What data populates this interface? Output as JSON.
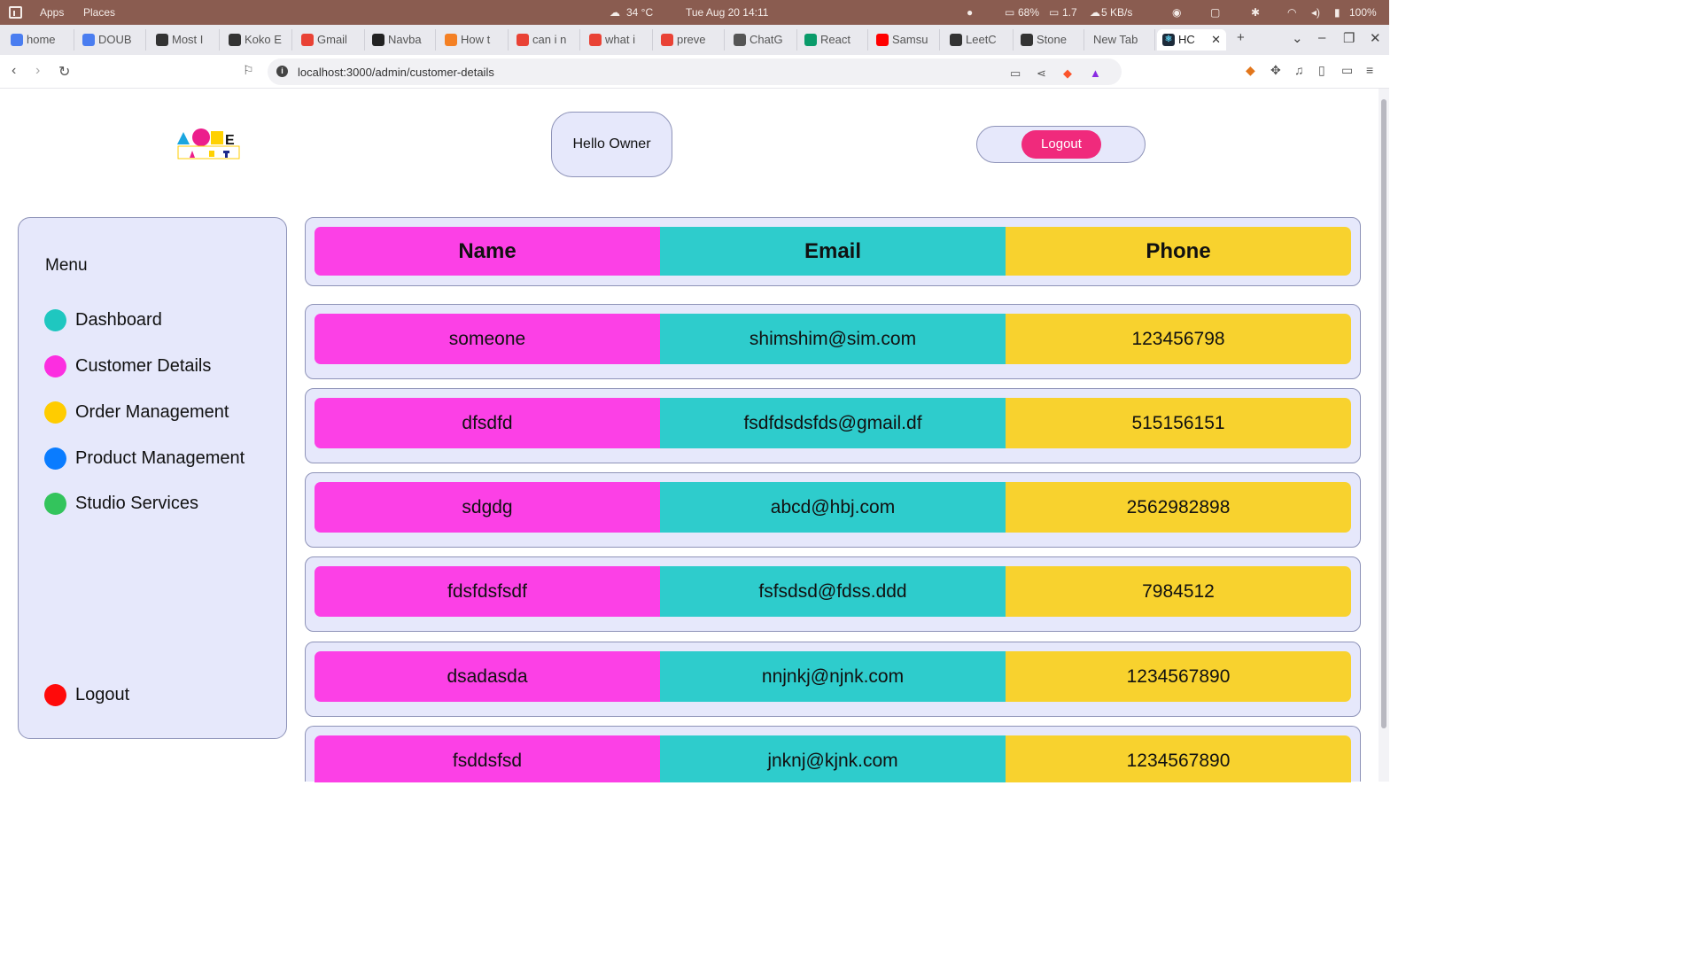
{
  "os_bar": {
    "apps": "Apps",
    "places": "Places",
    "weather": "34 °C",
    "datetime": "Tue Aug 20  14:11",
    "cpu": "68%",
    "load": "1.7",
    "net": "5 KB/s",
    "battery": "100%"
  },
  "tabs": [
    {
      "title": "home",
      "icon": "doc-icon",
      "color": "#4a7df0"
    },
    {
      "title": "DOUB",
      "icon": "doc-icon",
      "color": "#4a7df0"
    },
    {
      "title": "Most I",
      "icon": "leetcode-icon",
      "color": "#333333"
    },
    {
      "title": "Koko E",
      "icon": "leetcode-icon",
      "color": "#333333"
    },
    {
      "title": "Gmail",
      "icon": "google-icon",
      "color": "#e94235"
    },
    {
      "title": "Navba",
      "icon": "github-icon",
      "color": "#222222"
    },
    {
      "title": "How t",
      "icon": "stackoverflow-icon",
      "color": "#f48024"
    },
    {
      "title": "can i n",
      "icon": "google-icon",
      "color": "#e94235"
    },
    {
      "title": "what i",
      "icon": "google-icon",
      "color": "#e94235"
    },
    {
      "title": "preve",
      "icon": "google-icon",
      "color": "#e94235"
    },
    {
      "title": "ChatG",
      "icon": "chatgpt-icon",
      "color": "#555555"
    },
    {
      "title": "React",
      "icon": "w-icon",
      "color": "#0a9b6a"
    },
    {
      "title": "Samsu",
      "icon": "youtube-icon",
      "color": "#ff0000"
    },
    {
      "title": "LeetC",
      "icon": "leetcode-icon",
      "color": "#333333"
    },
    {
      "title": "Stone",
      "icon": "leetcode-icon",
      "color": "#333333"
    },
    {
      "title": "New Tab",
      "icon": "",
      "color": "#e9e9ee"
    }
  ],
  "active_tab": {
    "title": "HC",
    "icon": "react-icon"
  },
  "address_bar": {
    "url": "localhost:3000/admin/customer-details"
  },
  "header": {
    "greeting": "Hello Owner",
    "logout_label": "Logout"
  },
  "sidebar": {
    "title": "Menu",
    "items": [
      {
        "label": "Dashboard",
        "color": "#1fc7c0"
      },
      {
        "label": "Customer Details",
        "color": "#fc2ee0"
      },
      {
        "label": "Order Management",
        "color": "#ffcc00"
      },
      {
        "label": "Product Management",
        "color": "#0a7cff"
      },
      {
        "label": "Studio Services",
        "color": "#33c45c"
      }
    ],
    "logout": {
      "label": "Logout",
      "color": "#ff0a0a"
    }
  },
  "table": {
    "headers": [
      "Name",
      "Email",
      "Phone"
    ],
    "rows": [
      [
        "someone",
        "shimshim@sim.com",
        "123456798"
      ],
      [
        "dfsdfd",
        "fsdfdsdsfds@gmail.df",
        "515156151"
      ],
      [
        "sdgdg",
        "abcd@hbj.com",
        "2562982898"
      ],
      [
        "fdsfdsfsdf",
        "fsfsdsd@fdss.ddd",
        "7984512"
      ],
      [
        "dsadasda",
        "nnjnkj@njnk.com",
        "1234567890"
      ],
      [
        "fsddsfsd",
        "jnknj@kjnk.com",
        "1234567890"
      ]
    ]
  }
}
